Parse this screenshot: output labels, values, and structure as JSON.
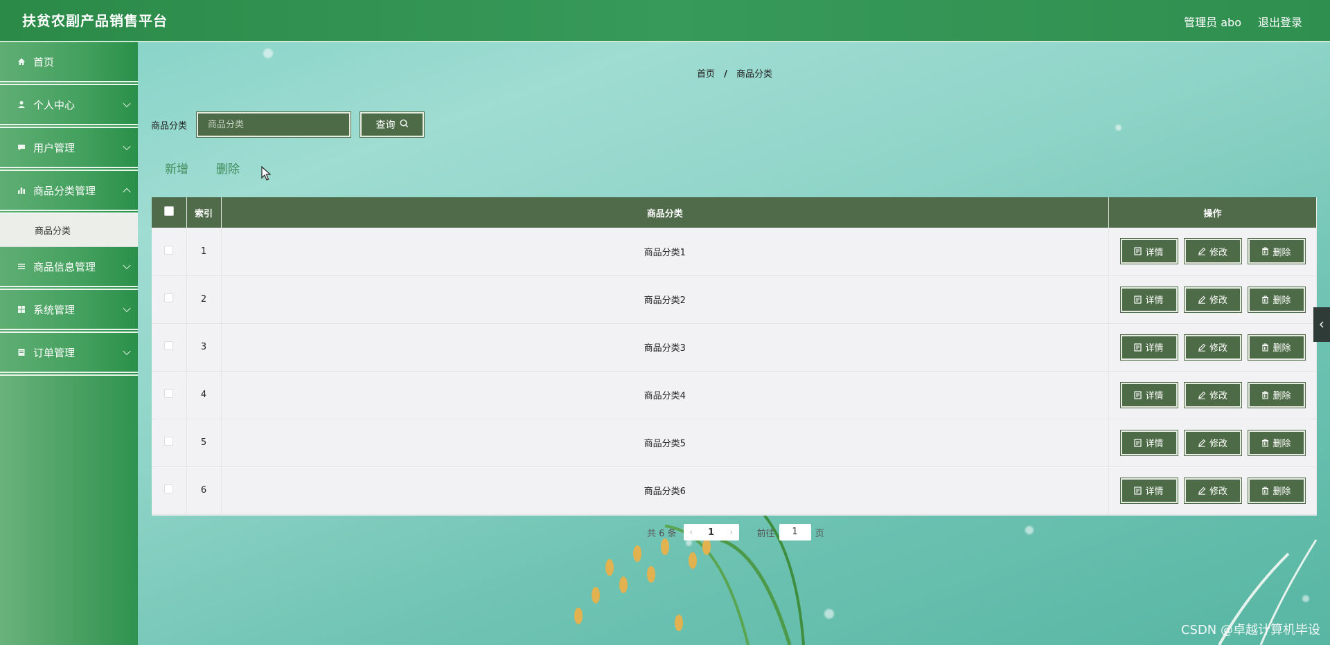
{
  "header": {
    "title": "扶贫农副产品销售平台",
    "user_label": "管理员 abo",
    "logout_label": "退出登录"
  },
  "sidebar": {
    "items": [
      {
        "label": "首页",
        "icon": "home-icon"
      },
      {
        "label": "个人中心",
        "icon": "user-icon"
      },
      {
        "label": "用户管理",
        "icon": "chat-icon"
      },
      {
        "label": "商品分类管理",
        "icon": "bar-chart-icon"
      },
      {
        "label": "商品信息管理",
        "icon": "list-icon"
      },
      {
        "label": "系统管理",
        "icon": "grid-icon"
      },
      {
        "label": "订单管理",
        "icon": "document-icon"
      }
    ],
    "active_sub": "商品分类"
  },
  "breadcrumb": {
    "home": "首页",
    "separator": "/",
    "current": "商品分类"
  },
  "search": {
    "label": "商品分类",
    "placeholder": "商品分类",
    "query_label": "查询"
  },
  "actions": {
    "add_label": "新增",
    "delete_label": "删除"
  },
  "table": {
    "headers": {
      "index": "索引",
      "category": "商品分类",
      "ops": "操作"
    },
    "rows": [
      {
        "index": "1",
        "category": "商品分类1"
      },
      {
        "index": "2",
        "category": "商品分类2"
      },
      {
        "index": "3",
        "category": "商品分类3"
      },
      {
        "index": "4",
        "category": "商品分类4"
      },
      {
        "index": "5",
        "category": "商品分类5"
      },
      {
        "index": "6",
        "category": "商品分类6"
      }
    ],
    "op_labels": {
      "detail": "详情",
      "edit": "修改",
      "delete": "删除"
    }
  },
  "pagination": {
    "total_text": "共 6 条",
    "current_page": "1",
    "goto_label": "前往",
    "goto_value": "1",
    "page_suffix": "页"
  },
  "watermark": "CSDN @卓越计算机毕设",
  "colors": {
    "header_green": "#37995a",
    "dark_button": "#4e6b47",
    "table_header": "#4f6b4a",
    "link_green": "#3d8a5a"
  }
}
